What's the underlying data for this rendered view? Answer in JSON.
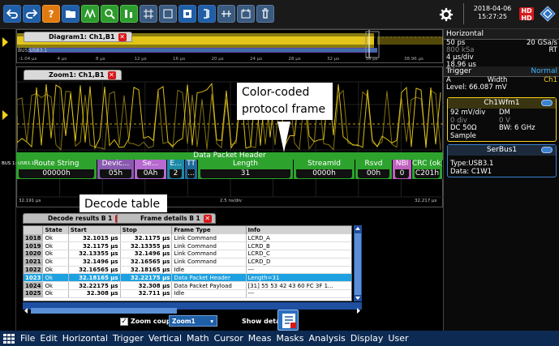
{
  "toolbar": {
    "date": "2018-04-06",
    "time": "15:27:25",
    "hd_badge_line1": "HD",
    "hd_badge_line2": "HD"
  },
  "horizontal": {
    "title": "Horizontal",
    "rows": [
      [
        "50 ps",
        "20 GSa/s"
      ],
      [
        "800 kSa",
        "RT"
      ],
      [
        "4 µs/div",
        ""
      ],
      [
        "18.96 µs",
        ""
      ]
    ]
  },
  "trigger": {
    "title": "Trigger",
    "mode": "Normal",
    "line1_left": "A",
    "line1_mid": "Width",
    "line1_right": "Ch1",
    "line2": "Level: 66.087 mV"
  },
  "ch1wfm": {
    "title": "Ch1Wfm1",
    "rows": [
      [
        "92 mV/div",
        "DM"
      ],
      [
        "0 div",
        "0 V"
      ],
      [
        "DC 50Ω",
        "BW: 6 GHz"
      ],
      [
        "Sample",
        ""
      ]
    ]
  },
  "serbus": {
    "title": "SerBus1",
    "line1": "Type:USB3.1",
    "line2": "Data: C1W1"
  },
  "diagram1": {
    "tab": "Diagram1: Ch1,B1",
    "bus_label": "BUS:USB3.1",
    "ticks": [
      "-1.04 µs",
      "4 µs",
      "8 µs",
      "12 µs",
      "16 µs",
      "20 µs",
      "24 µs",
      "28 µs",
      "32 µs",
      "36 µs",
      "38.96 µs"
    ]
  },
  "zoom1": {
    "tab": "Zoom1: Ch1,B1",
    "bus_label": "BUS 1: USB3.1",
    "ticks_left": "32.191 µs",
    "ticks_mid": "2.5 ns/div",
    "ticks_right": "32.217 µs"
  },
  "frame": {
    "header": "Data Packet Header",
    "segments": [
      {
        "name": "Route String",
        "value": "00000h",
        "color": "#2da32d"
      },
      {
        "name": "Devic...",
        "value": "05h",
        "color": "#8a5ab0"
      },
      {
        "name": "Se...",
        "value": "0Ah",
        "color": "#b66ad0"
      },
      {
        "name": "E...",
        "value": "2",
        "color": "#1e8aa8"
      },
      {
        "name": "TT",
        "value": "...",
        "color": "#1e6a9a"
      },
      {
        "name": "Length",
        "value": "31",
        "color": "#2da32d"
      },
      {
        "name": "StreamId",
        "value": "0000h",
        "color": "#2da32d"
      },
      {
        "name": "Rsvd",
        "value": "00h",
        "color": "#2da32d"
      },
      {
        "name": "NBI",
        "value": "0",
        "color": "#c060c0"
      },
      {
        "name": "CRC (ok)",
        "value": "C201h",
        "color": "#2da32d"
      }
    ]
  },
  "callouts": {
    "protocol": "Color-coded protocol frame",
    "decode": "Decode table"
  },
  "table_window": {
    "tab1": "Decode results B 1",
    "tab2": "Frame details B 1",
    "columns": [
      "",
      "State",
      "Start",
      "Stop",
      "Frame Type",
      "Info"
    ],
    "rows": [
      {
        "idx": "1018",
        "state": "Ok",
        "start": "32.1015 µs",
        "stop": "32.1175 µs",
        "type": "Link Command",
        "info": "LCRD_A"
      },
      {
        "idx": "1019",
        "state": "Ok",
        "start": "32.1175 µs",
        "stop": "32.13355 µs",
        "type": "Link Command",
        "info": "LCRD_B"
      },
      {
        "idx": "1020",
        "state": "Ok",
        "start": "32.13355 µs",
        "stop": "32.1496 µs",
        "type": "Link Command",
        "info": "LCRD_C"
      },
      {
        "idx": "1021",
        "state": "Ok",
        "start": "32.1496 µs",
        "stop": "32.16565 µs",
        "type": "Link Command",
        "info": "LCRD_D"
      },
      {
        "idx": "1022",
        "state": "Ok",
        "start": "32.16565 µs",
        "stop": "32.18165 µs",
        "type": "Idle",
        "info": "---"
      },
      {
        "idx": "1023",
        "state": "Ok",
        "start": "32.18165 µs",
        "stop": "32.22175 µs",
        "type": "Data Packet Header",
        "info": "Length=31"
      },
      {
        "idx": "1024",
        "state": "Ok",
        "start": "32.22175 µs",
        "stop": "32.308 µs",
        "type": "Data Packet Payload",
        "info": "[31] 55 53 42 43 60 FC 3F 1..."
      },
      {
        "idx": "1025",
        "state": "Ok",
        "start": "32.308 µs",
        "stop": "32.711 µs",
        "type": "Idle",
        "info": "---"
      }
    ],
    "selected_idx": "1023",
    "zoom_coupling_label": "Zoom coupling",
    "zoom_select_value": "Zoom1",
    "show_details_label": "Show details"
  },
  "menu": {
    "items": [
      "File",
      "Edit",
      "Horizontal",
      "Trigger",
      "Vertical",
      "Math",
      "Cursor",
      "Meas",
      "Masks",
      "Analysis",
      "Display",
      "User"
    ]
  },
  "colors": {
    "accent_blue": "#1f5fa8",
    "protocol_green": "#2da32d",
    "waveform_yellow": "#f2d21b",
    "selection_cyan": "#1da1e0",
    "close_red": "#d7191c"
  }
}
